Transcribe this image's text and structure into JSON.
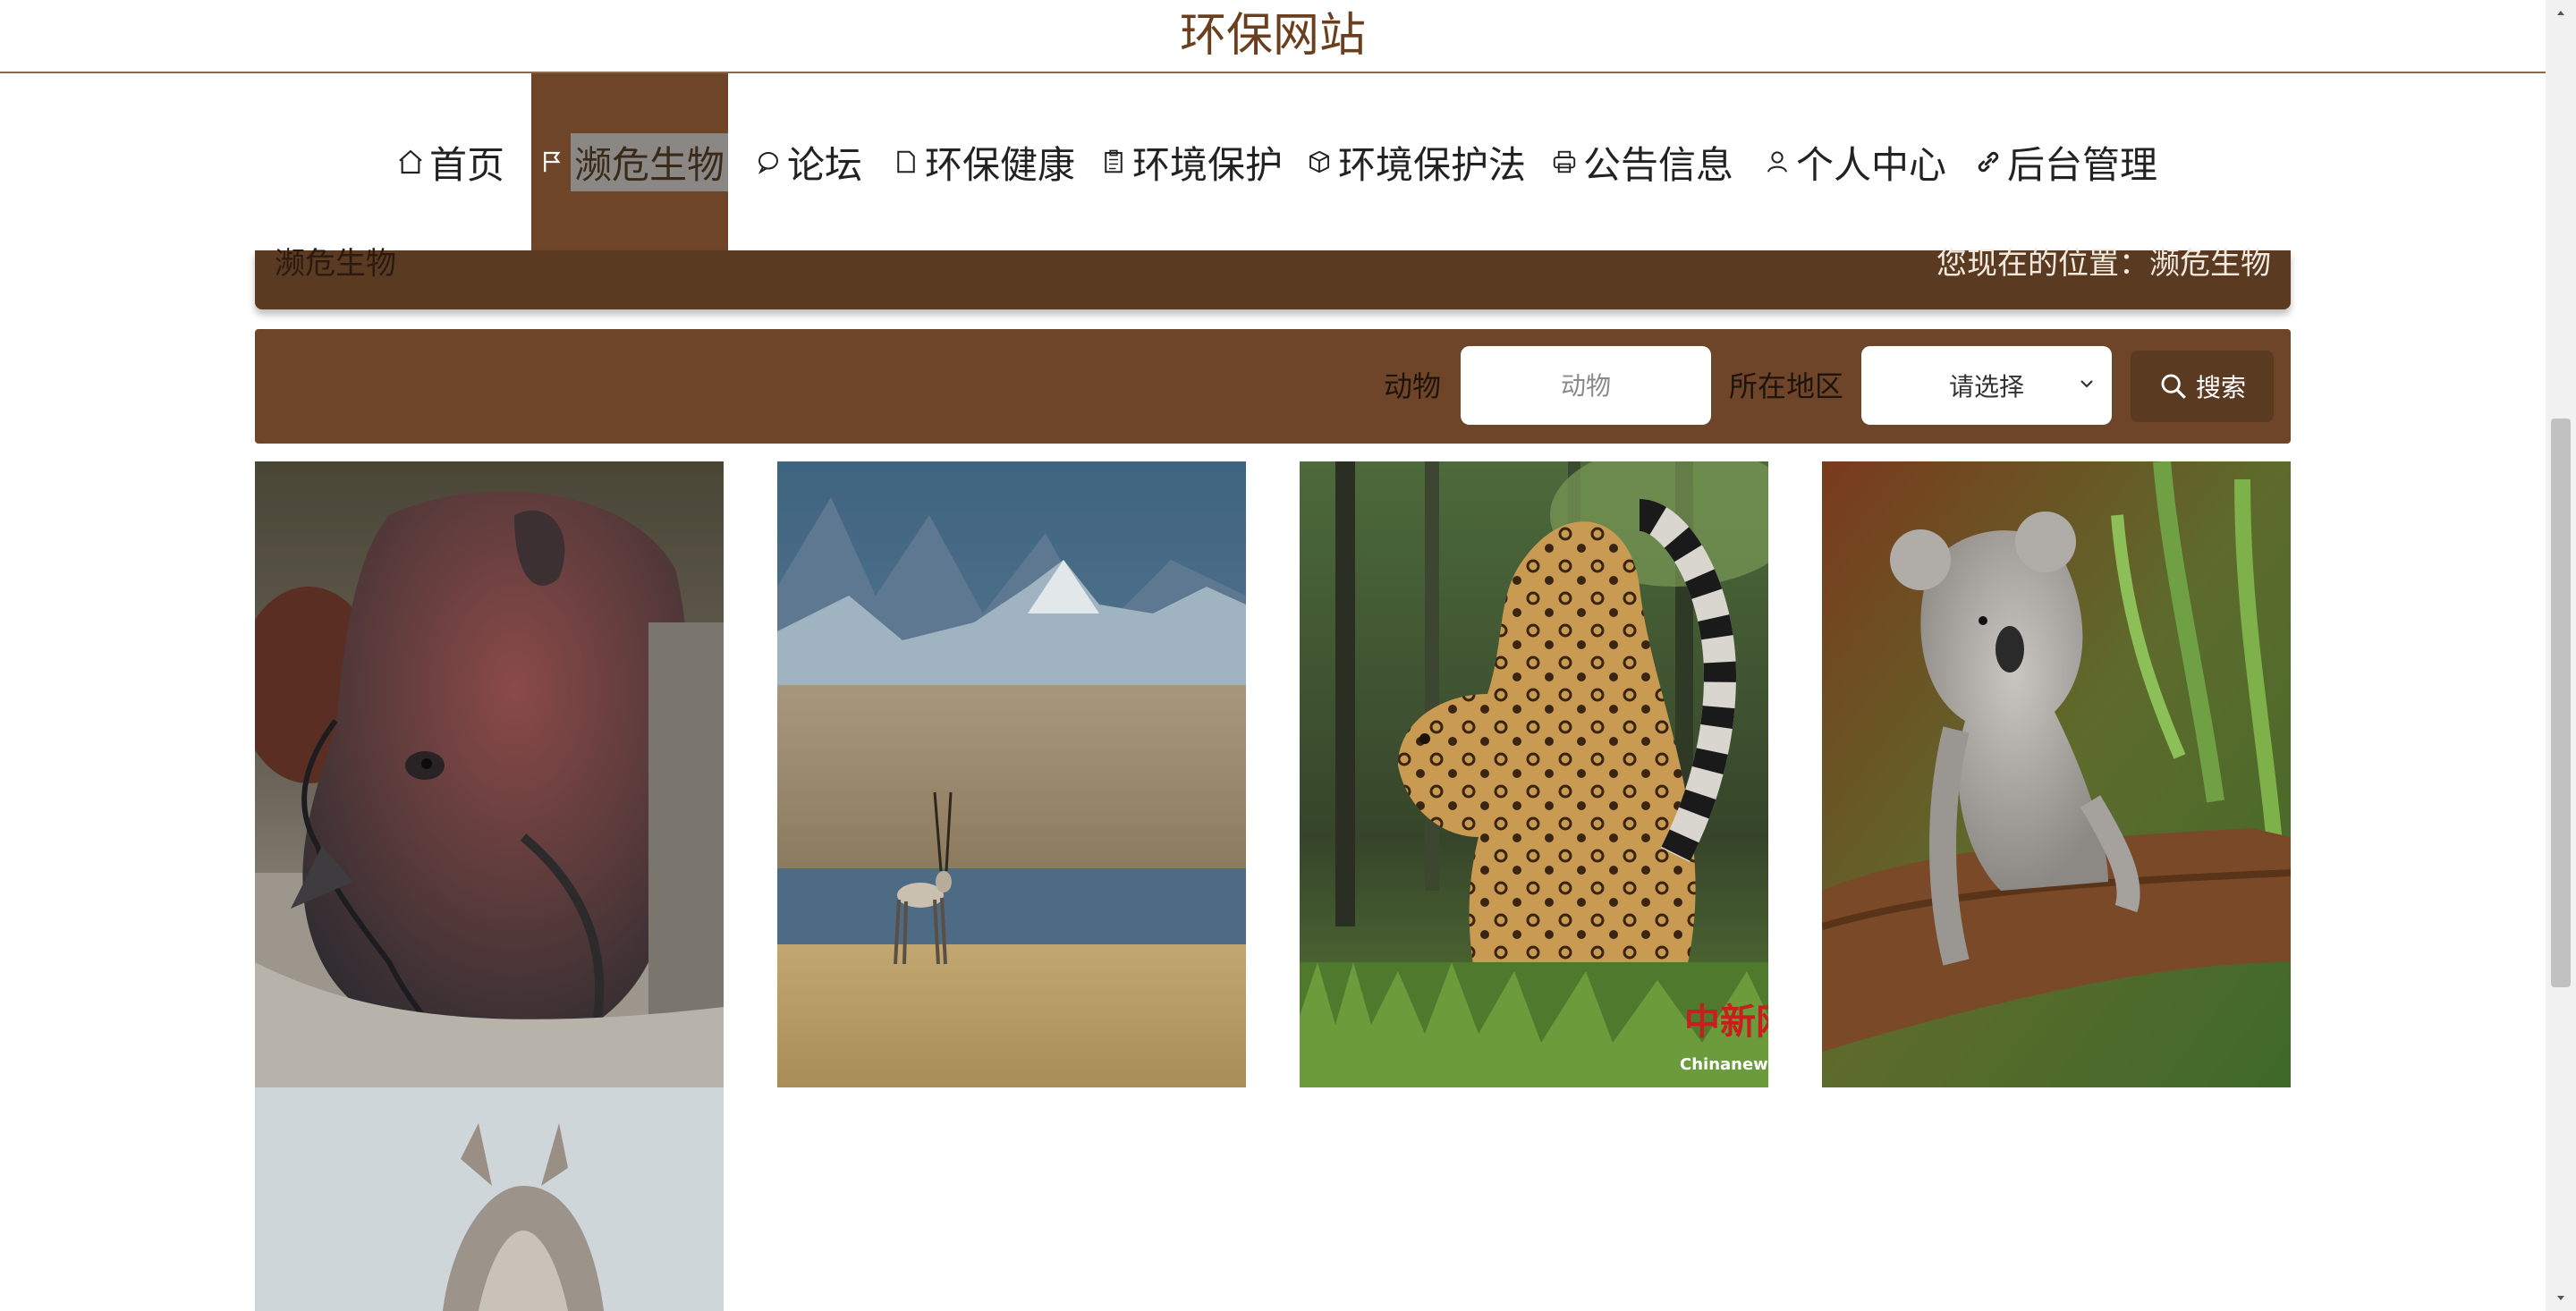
{
  "site": {
    "title": "环保网站"
  },
  "nav": {
    "items": [
      {
        "label": "首页",
        "icon": "home-icon"
      },
      {
        "label": "濒危生物",
        "icon": "flag-icon",
        "active": true
      },
      {
        "label": "论坛",
        "icon": "chat-bubble-icon"
      },
      {
        "label": "环保健康",
        "icon": "document-icon"
      },
      {
        "label": "环境保护",
        "icon": "clipboard-icon"
      },
      {
        "label": "环境保护法",
        "icon": "cube-icon"
      },
      {
        "label": "公告信息",
        "icon": "printer-icon"
      },
      {
        "label": "个人中心",
        "icon": "user-icon"
      },
      {
        "label": "后台管理",
        "icon": "link-icon"
      }
    ]
  },
  "breadcrumb": {
    "section": "濒危生物",
    "location": "您现在的位置：濒危生物"
  },
  "search": {
    "animal_label": "动物",
    "animal_placeholder": "动物",
    "region_label": "所在地区",
    "region_selected": "请选择",
    "button_label": "搜索"
  },
  "gallery": {
    "items": [
      {
        "subject": "rhinoceros"
      },
      {
        "subject": "tibetan-antelope"
      },
      {
        "subject": "leopard",
        "watermark_text": "中新网",
        "watermark_sub": "Chinanews.com"
      },
      {
        "subject": "koala"
      },
      {
        "subject": "fox"
      }
    ]
  },
  "colors": {
    "brand_brown": "#6e4528",
    "dark_brown": "#5b3a22",
    "title_brown": "#6b3f1d"
  }
}
